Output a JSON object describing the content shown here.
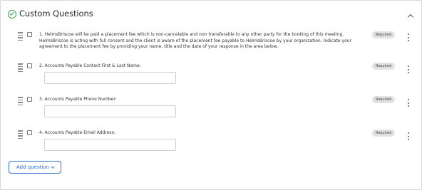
{
  "section": {
    "title": "Custom Questions",
    "status_icon": "check-circle-icon",
    "collapse_icon": "chevron-up-icon",
    "accent_color": "#3aa657"
  },
  "questions": [
    {
      "text": "1. HelmsBriscoe will be paid a placement fee which is non-cancelable and non transferable to any other party for the booking of this meeting. HelmsBriscoe is acting with full consent and the client is aware of the placement fee payable to HelmsBriscoe by your organization. Indicate your agreement to the placement fee by providing your name, title and the date of your response in the area below.",
      "badge": "Required",
      "has_answer_field": false
    },
    {
      "text": "2. Accounts Payable Contact First & Last Name:",
      "badge": "Required",
      "answer_value": "",
      "has_answer_field": true
    },
    {
      "text": "3. Accounts Payable Phone Number:",
      "badge": "Required",
      "answer_value": "",
      "has_answer_field": true
    },
    {
      "text": "4. Accounts Payable Email Address:",
      "badge": "Required",
      "answer_value": "",
      "has_answer_field": true
    }
  ],
  "add_button": {
    "label": "Add question",
    "icon": "chevron-down-icon",
    "color": "#2f6fd1"
  }
}
